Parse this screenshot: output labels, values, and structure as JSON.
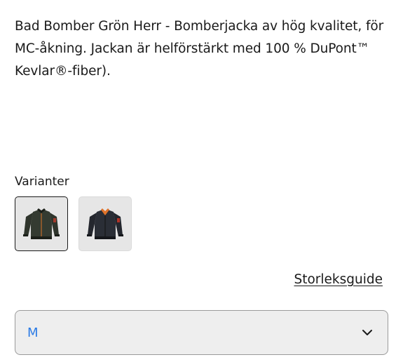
{
  "product": {
    "description": "Bad Bomber Grön Herr - Bomberjacka av hög kvalitet, för MC-åkning. Jackan är helförstärkt med 100 % DuPont™ Kevlar®-fiber)."
  },
  "variants": {
    "heading": "Varianter",
    "items": [
      {
        "name": "green-jacket",
        "selected": true,
        "body_color": "#2f352c",
        "accent_color": "#c06a2a"
      },
      {
        "name": "black-jacket",
        "selected": false,
        "body_color": "#24272e",
        "accent_color": "#e0732a"
      }
    ]
  },
  "size_guide": {
    "label": "Storleksguide"
  },
  "size_select": {
    "value": "M",
    "icon": "chevron-down-icon"
  },
  "colors": {
    "select_value": "#2c7be5",
    "text": "#1a1a1a"
  }
}
